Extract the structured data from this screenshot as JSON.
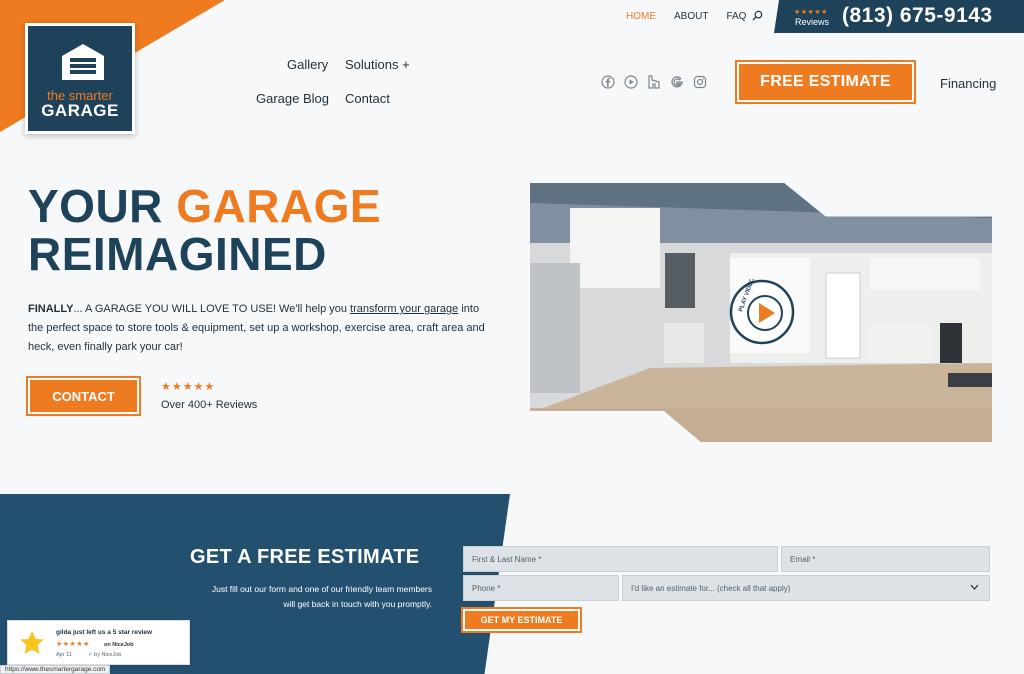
{
  "brand": {
    "logo_line1": "the smarter",
    "logo_line2": "GARAGE",
    "orange": "#ef7b21",
    "navy": "#1e4259"
  },
  "topbar": {
    "links": [
      "HOME",
      "ABOUT",
      "FAQ"
    ],
    "stars": "★★★★★",
    "reviews_label": "Reviews",
    "phone": "(813) 675-9143"
  },
  "nav": {
    "gallery": "Gallery",
    "solutions": "Solutions +",
    "blog": "Garage Blog",
    "contact": "Contact"
  },
  "social": [
    "facebook-icon",
    "youtube-icon",
    "houzz-icon",
    "google-icon",
    "instagram-icon"
  ],
  "header_cta": {
    "estimate": "FREE ESTIMATE",
    "financing": "Financing"
  },
  "hero": {
    "headline_part1": "YOUR ",
    "headline_part2": "GARAGE",
    "headline_line2": "REIMAGINED",
    "intro_bold": "FINALLY",
    "intro_a": "... A GARAGE YOU WILL LOVE TO USE! We'll help you ",
    "intro_link": "transform your garage",
    "intro_b": " into the perfect space to store tools & equipment, set up a workshop, exercise area, craft area and heck, even finally park your car!",
    "contact_btn": "CONTACT",
    "stars": "★★★★★",
    "reviews": "Over 400+ Reviews",
    "play_label": "PLAY VIDEO"
  },
  "estimate": {
    "title": "GET A FREE ESTIMATE",
    "subtitle": "Just fill out our form and one of our friendly team members will get back in touch with you promptly.",
    "name_placeholder": "First & Last Name *",
    "email_placeholder": "Email *",
    "phone_placeholder": "Phone *",
    "select_value": "I'd like an estimate for... (check all that apply)",
    "submit": "GET MY ESTIMATE"
  },
  "nicejob": {
    "line1": "gilda just left us a 5 star review",
    "stars": "★★★★★",
    "on": "on NiceJob",
    "date": "Apr 11",
    "by": "✓ by NiceJob"
  },
  "status_url": "https://www.thesmartergarage.com"
}
